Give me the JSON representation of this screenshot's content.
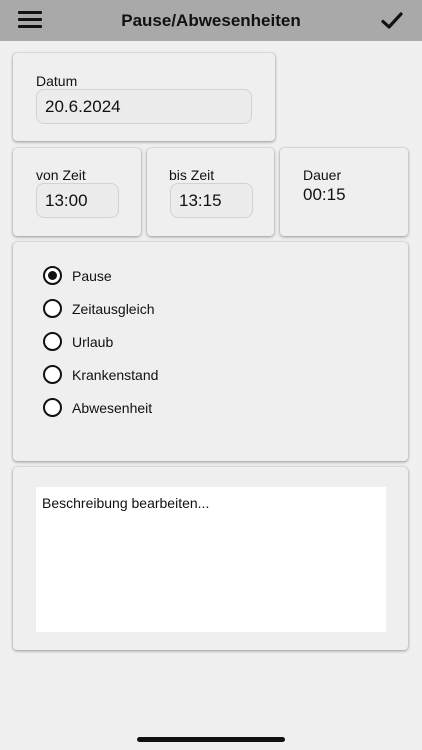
{
  "header": {
    "title": "Pause/Abwesenheiten",
    "menu_icon": "hamburger-icon",
    "confirm_icon": "checkmark-icon"
  },
  "date": {
    "label": "Datum",
    "value": "20.6.2024"
  },
  "time": {
    "from_label": "von Zeit",
    "from_value": "13:00",
    "to_label": "bis Zeit",
    "to_value": "13:15",
    "duration_label": "Dauer",
    "duration_value": "00:15"
  },
  "absence_type": {
    "selected": "Pause",
    "options": [
      "Pause",
      "Zeitausgleich",
      "Urlaub",
      "Krankenstand",
      "Abwesenheit"
    ]
  },
  "description": {
    "placeholder": "Beschreibung bearbeiten..."
  },
  "colors": {
    "topbar": "#a9a9a9",
    "background": "#f0f0f0",
    "card": "#efefef"
  }
}
